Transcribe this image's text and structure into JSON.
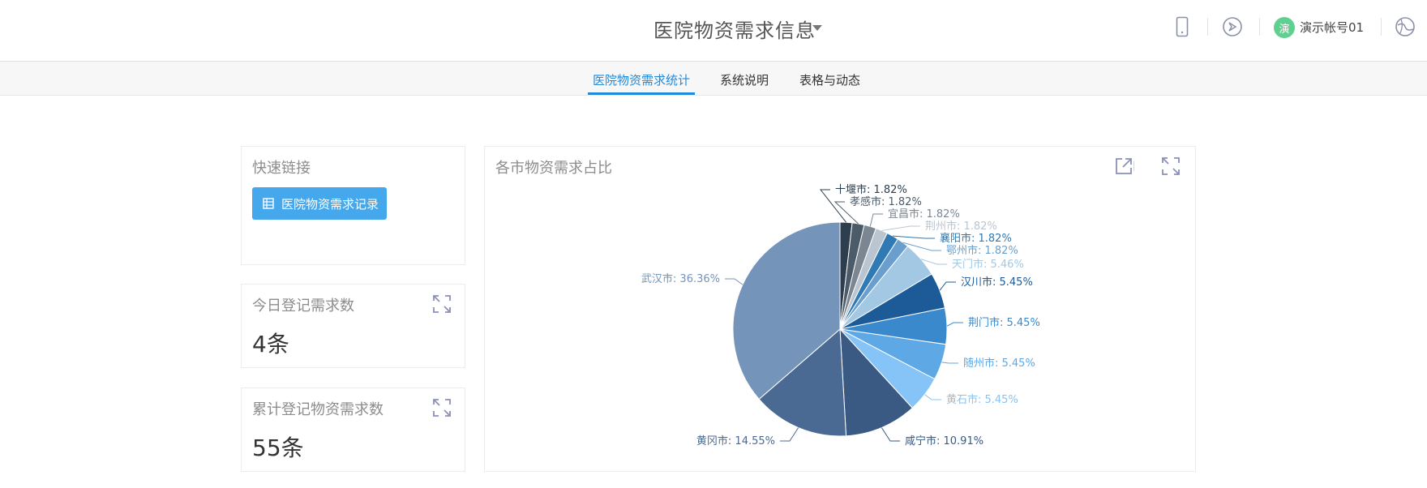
{
  "header": {
    "title": "医院物资需求信息",
    "user_avatar_char": "演",
    "user_name": "演示帐号01",
    "icons": [
      "mobile-icon",
      "compass-icon",
      "user-avatar",
      "globe-logo-icon"
    ]
  },
  "tabs": [
    {
      "label": "医院物资需求统计",
      "active": true
    },
    {
      "label": "系统说明",
      "active": false
    },
    {
      "label": "表格与动态",
      "active": false
    }
  ],
  "quick_links": {
    "title": "快速链接",
    "button_label": "医院物资需求记录"
  },
  "today_count": {
    "title": "今日登记需求数",
    "value": "4条"
  },
  "total_count": {
    "title": "累计登记物资需求数",
    "value": "55条"
  },
  "chart_card": {
    "title": "各市物资需求占比",
    "toolbox": [
      "open-new-icon",
      "fullscreen-icon"
    ]
  },
  "colors": {
    "accent": "#2389d9",
    "button": "#45a8ec",
    "avatar": "#5fd08f"
  },
  "chart_data": {
    "type": "pie",
    "title": "各市物资需求占比",
    "slices": [
      {
        "name": "十堰市",
        "value": 1.82,
        "label": "十堰市: 1.82%",
        "color": "#2d3e4f"
      },
      {
        "name": "孝感市",
        "value": 1.82,
        "label": "孝感市: 1.82%",
        "color": "#4c5b6a"
      },
      {
        "name": "宜昌市",
        "value": 1.82,
        "label": "宜昌市: 1.82%",
        "color": "#7a8793"
      },
      {
        "name": "荆州市",
        "value": 1.82,
        "label": "荆州市: 1.82%",
        "color": "#b9c5d1"
      },
      {
        "name": "襄阳市",
        "value": 1.82,
        "label": "襄阳市: 1.82%",
        "color": "#2f79b5"
      },
      {
        "name": "鄂州市",
        "value": 1.82,
        "label": "鄂州市: 1.82%",
        "color": "#6a9fcd"
      },
      {
        "name": "天门市",
        "value": 5.46,
        "label": "天门市: 5.46%",
        "color": "#a3c8e4"
      },
      {
        "name": "汉川市",
        "value": 5.45,
        "label": "汉川市: 5.45%",
        "color": "#1d5a98"
      },
      {
        "name": "荆门市",
        "value": 5.45,
        "label": "荆门市: 5.45%",
        "color": "#3b89cd"
      },
      {
        "name": "随州市",
        "value": 5.45,
        "label": "随州市: 5.45%",
        "color": "#5ea8e6"
      },
      {
        "name": "黄石市",
        "value": 5.45,
        "label": "黄石市: 5.45%",
        "color": "#86c3f7"
      },
      {
        "name": "咸宁市",
        "value": 10.91,
        "label": "咸宁市: 10.91%",
        "color": "#3a5a83"
      },
      {
        "name": "黄冈市",
        "value": 14.55,
        "label": "黄冈市: 14.55%",
        "color": "#4b6a93"
      },
      {
        "name": "武汉市",
        "value": 36.36,
        "label": "武汉市: 36.36%",
        "color": "#7494b9"
      }
    ]
  }
}
